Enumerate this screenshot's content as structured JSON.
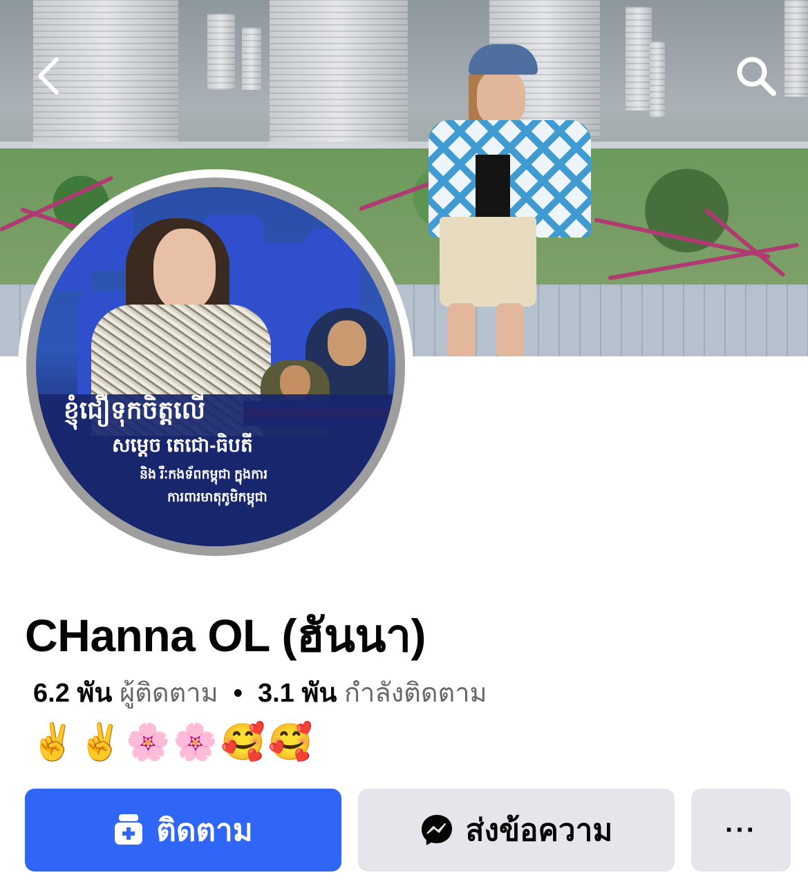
{
  "profile": {
    "name": "CHanna OL (ฮันนา)",
    "followers_count": "6.2 พัน",
    "followers_label": "ผู้ติดตาม",
    "separator": "•",
    "following_count": "3.1 พัน",
    "following_label": "กำลังติดตาม",
    "bio": "✌️✌️🌸🌸🥰🥰"
  },
  "avatar_text": {
    "line1": "ខ្ញុំជឿទុកចិត្តលើ",
    "line2": "សម្តេច តេជោ-ធិបតី",
    "line3": "និង រឹៈកងទ័ពកម្ពុជា ក្នុងការ",
    "line4": "ការពារមាតុភូមិកម្ពុជា"
  },
  "actions": {
    "follow_label": "ติดตาม",
    "message_label": "ส่งข้อความ",
    "more_label": "···"
  },
  "icons": {
    "back": "chevron-left-icon",
    "search": "search-icon",
    "follow": "add-friend-icon",
    "message": "messenger-icon"
  },
  "colors": {
    "follow_button": "#2f66f5",
    "secondary_button": "#e4e6eb",
    "muted_text": "#65676b"
  }
}
